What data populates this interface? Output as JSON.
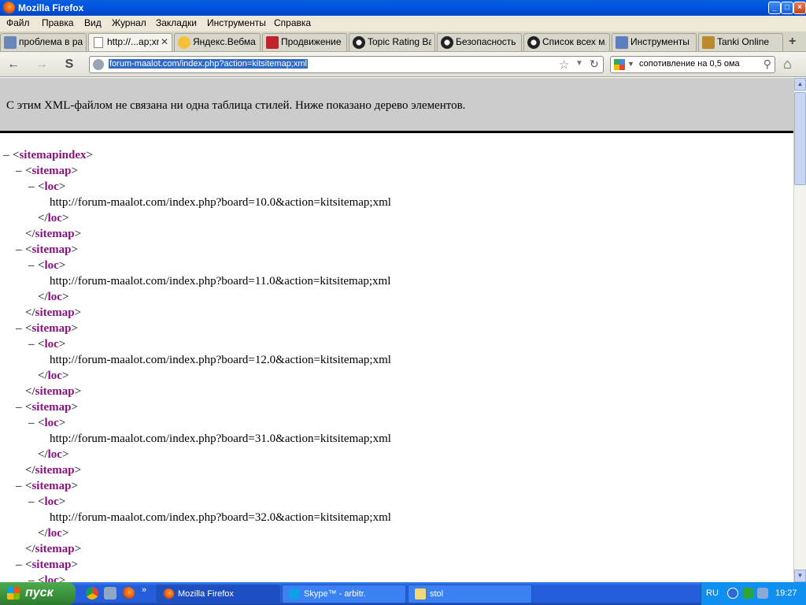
{
  "window": {
    "title": "Mozilla Firefox",
    "controls": [
      "_",
      "□",
      "×"
    ]
  },
  "menu": [
    "Файл",
    "Правка",
    "Вид",
    "Журнал",
    "Закладки",
    "Инструменты",
    "Справка"
  ],
  "tabs": [
    {
      "label": "проблема в ра...",
      "icon": "nested-forum-icon",
      "active": false
    },
    {
      "label": "http://...ap;xml",
      "icon": "blank-page-icon",
      "active": true
    },
    {
      "label": "Яндекс.Вебма...",
      "icon": "yandex-icon",
      "active": false
    },
    {
      "label": "Продвижение ...",
      "icon": "we-icon",
      "active": false
    },
    {
      "label": "Topic Rating Ba...",
      "icon": "panda-icon",
      "active": false
    },
    {
      "label": "Безопасность",
      "icon": "panda-icon",
      "active": false
    },
    {
      "label": "Список всех м...",
      "icon": "panda-icon",
      "active": false
    },
    {
      "label": "Инструменты ...",
      "icon": "tools-icon",
      "active": false
    },
    {
      "label": "Tanki Online",
      "icon": "tank-icon",
      "active": false
    }
  ],
  "navbar": {
    "url": "forum-maalot.com/index.php?action=kitsitemap;xml",
    "search": "сопотивление на 0,5 ома"
  },
  "info_text": "С этим XML-файлом не связана ни одна таблица стилей. Ниже показано дерево элементов.",
  "xml": {
    "root": "sitemapindex",
    "entry": "sitemap",
    "loc_tag": "loc",
    "collapse_marker": "–",
    "locs": [
      "http://forum-maalot.com/index.php?board=10.0&action=kitsitemap;xml",
      "http://forum-maalot.com/index.php?board=11.0&action=kitsitemap;xml",
      "http://forum-maalot.com/index.php?board=12.0&action=kitsitemap;xml",
      "http://forum-maalot.com/index.php?board=31.0&action=kitsitemap;xml",
      "http://forum-maalot.com/index.php?board=32.0&action=kitsitemap;xml"
    ]
  },
  "taskbar": {
    "start_label": "пуск",
    "tasks": [
      {
        "label": "Mozilla Firefox",
        "icon": "firefox-icon",
        "active": true
      },
      {
        "label": "Skype™ - arbitr.",
        "icon": "skype-icon",
        "active": false
      },
      {
        "label": "stol",
        "icon": "folder-icon",
        "active": false
      }
    ],
    "language": "RU",
    "clock": "19:27"
  },
  "colors": {
    "xml_tag": "#881280",
    "info_bg": "#cccccc",
    "title_bar": "#0054e3",
    "taskbar": "#245edb",
    "start_button": "#3a8f3a"
  }
}
